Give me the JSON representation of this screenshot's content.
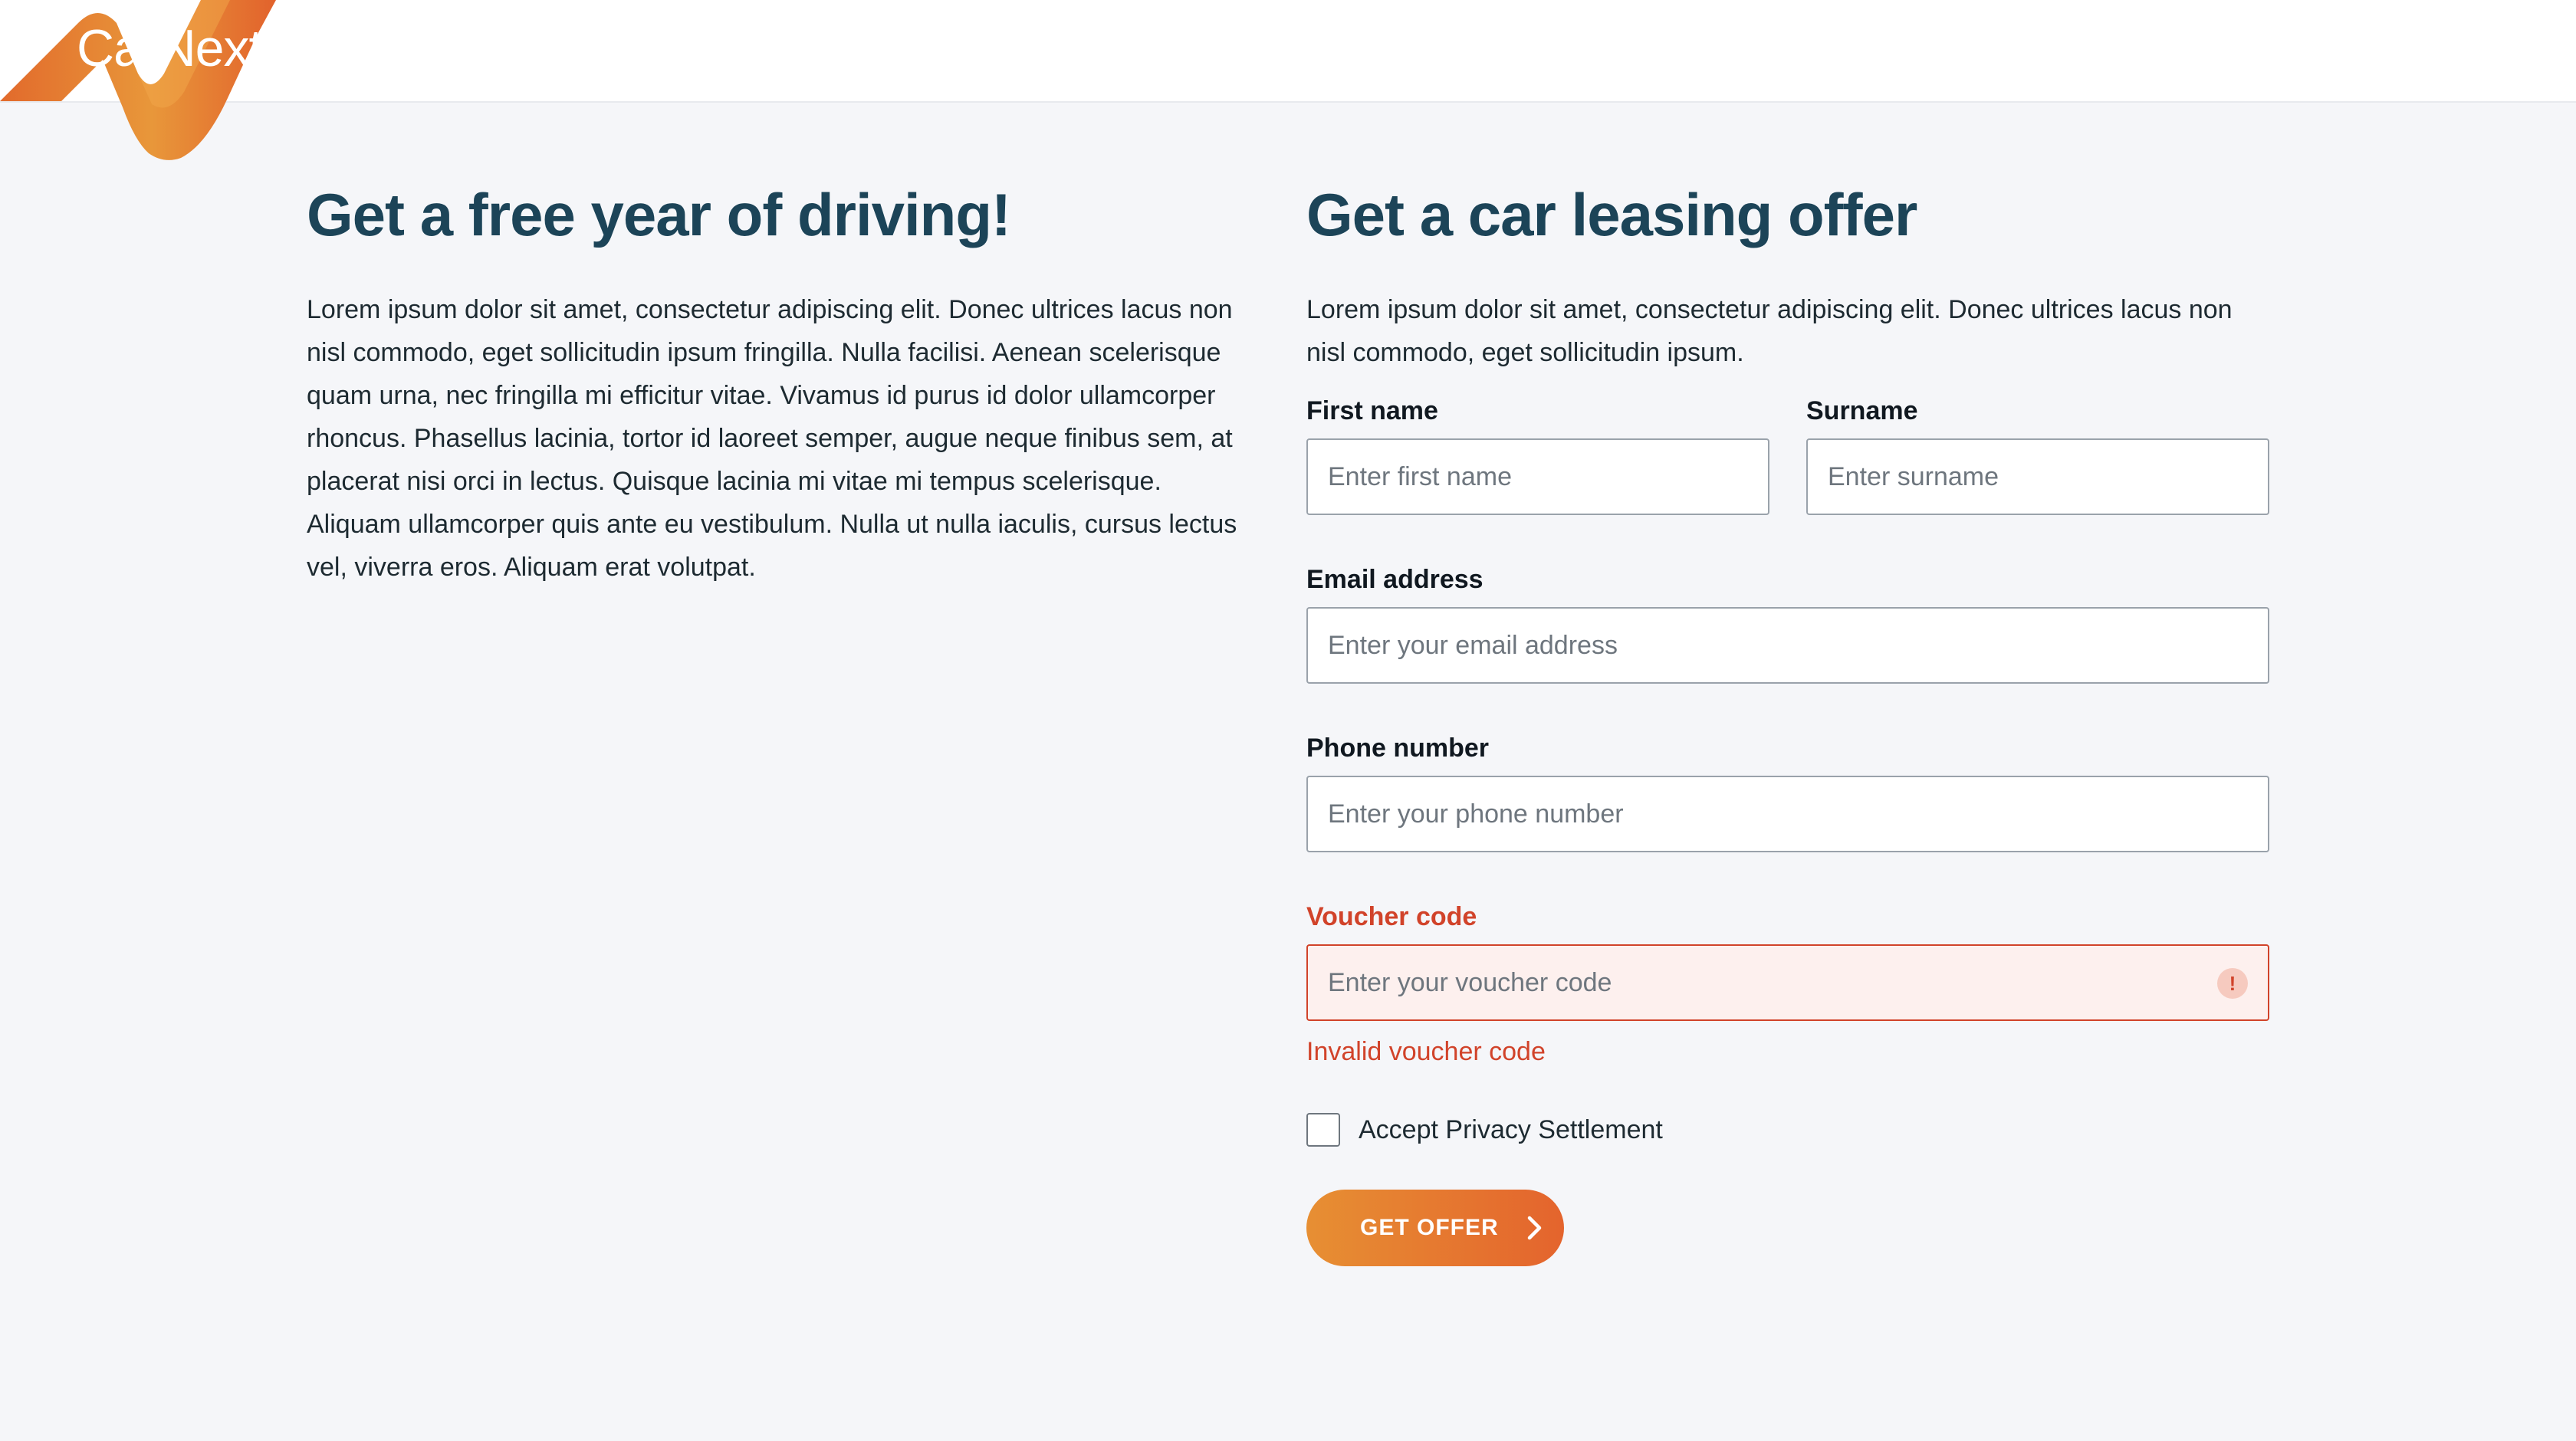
{
  "brand": {
    "name": "CarNext",
    "colors": {
      "accent_start": "#e78f33",
      "accent_end": "#e4642d",
      "heading": "#1c4458",
      "error": "#d1432a"
    }
  },
  "promo": {
    "title": "Get a free year of driving!",
    "body": "Lorem ipsum dolor sit amet, consectetur adipiscing elit. Donec ultrices lacus non nisl commodo, eget sollicitudin ipsum fringilla. Nulla facilisi. Aenean scelerisque quam urna, nec fringilla mi efficitur vitae. Vivamus id purus id dolor ullamcorper rhoncus. Phasellus lacinia, tortor id laoreet semper, augue neque finibus sem, at placerat nisi orci in lectus. Quisque lacinia mi vitae mi tempus scelerisque. Aliquam ullamcorper quis ante eu vestibulum. Nulla ut nulla iaculis, cursus lectus vel, viverra eros. Aliquam erat volutpat."
  },
  "form": {
    "title": "Get a car leasing offer",
    "intro": "Lorem ipsum dolor sit amet, consectetur adipiscing elit. Donec ultrices lacus non nisl commodo, eget sollicitudin ipsum.",
    "first_name": {
      "label": "First name",
      "placeholder": "Enter first name",
      "value": ""
    },
    "surname": {
      "label": "Surname",
      "placeholder": "Enter surname",
      "value": ""
    },
    "email": {
      "label": "Email address",
      "placeholder": "Enter your email address",
      "value": ""
    },
    "phone": {
      "label": "Phone number",
      "placeholder": "Enter your phone number",
      "value": ""
    },
    "voucher": {
      "label": "Voucher code",
      "placeholder": "Enter your voucher code",
      "value": "",
      "error_icon": "!",
      "error": "Invalid voucher code"
    },
    "privacy": {
      "label": "Accept Privacy Settlement",
      "checked": false
    },
    "submit_label": "GET OFFER",
    "submit_icon": "chevron-right-icon"
  }
}
